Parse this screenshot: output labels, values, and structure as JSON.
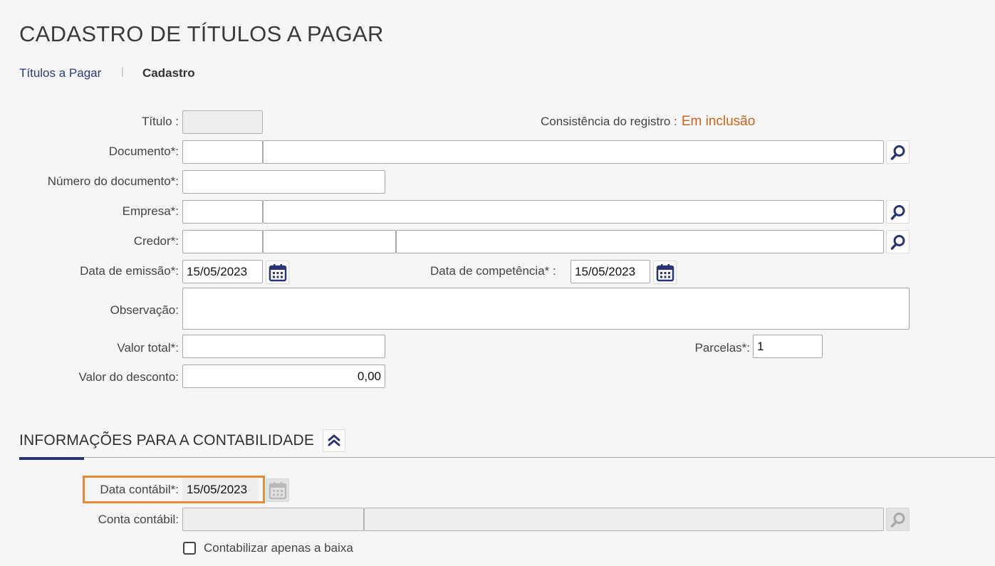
{
  "page": {
    "title": "CADASTRO DE TÍTULOS A PAGAR"
  },
  "breadcrumb": {
    "parent": "Títulos a Pagar",
    "separator": "|",
    "current": "Cadastro"
  },
  "form": {
    "titulo_label": "Título :",
    "titulo_value": "",
    "consistencia_label": "Consistência do registro :",
    "consistencia_value": "Em inclusão",
    "documento_label": "Documento*:",
    "documento_code": "",
    "documento_desc": "",
    "numero_documento_label": "Número do documento*:",
    "numero_documento_value": "",
    "empresa_label": "Empresa*:",
    "empresa_code": "",
    "empresa_desc": "",
    "credor_label": "Credor*:",
    "credor_code": "",
    "credor_doc": "",
    "credor_name": "",
    "data_emissao_label": "Data de emissão*:",
    "data_emissao_value": "15/05/2023",
    "data_competencia_label": "Data de competência* :",
    "data_competencia_value": "15/05/2023",
    "observacao_label": "Observação:",
    "observacao_value": "",
    "valor_total_label": "Valor total*:",
    "valor_total_value": "",
    "parcelas_label": "Parcelas*:",
    "parcelas_value": "1",
    "valor_desconto_label": "Valor do desconto:",
    "valor_desconto_value": "0,00"
  },
  "contabilidade": {
    "section_title": "INFORMAÇÕES PARA A CONTABILIDADE",
    "data_contabil_label": "Data contábil*:",
    "data_contabil_value": "15/05/2023",
    "conta_contabil_label": "Conta contábil:",
    "conta_code": "",
    "conta_desc": "",
    "contabilizar_label": "Contabilizar apenas a baixa",
    "contabilizar_checked": false
  },
  "icons": {
    "search": "search-icon",
    "calendar": "calendar-icon",
    "collapse": "chevron-double-up-icon"
  },
  "colors": {
    "accent": "#2a3474",
    "status": "#c8651b",
    "highlight": "#e48a3c"
  }
}
